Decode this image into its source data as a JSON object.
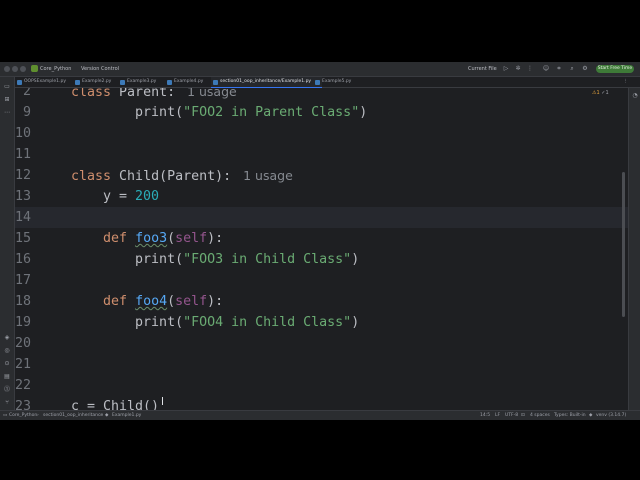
{
  "titlebar": {
    "project": "Core_Python",
    "vcs": "Version Control",
    "run_config": "Current File",
    "start_free_time": "Start Free Time"
  },
  "tabs": [
    {
      "label": "OOPSExample1.py",
      "active": false
    },
    {
      "label": "Example2.py",
      "active": false
    },
    {
      "label": "Example3.py",
      "active": false
    },
    {
      "label": "Example4.py",
      "active": false
    },
    {
      "label": "section01_oop_inheritance/Example1.py",
      "active": true
    },
    {
      "label": "Example5.py",
      "active": false
    }
  ],
  "inspections": {
    "warnings": "1",
    "weak": "1"
  },
  "editor": {
    "lines": [
      {
        "n": "2",
        "parts": [
          {
            "t": "kw",
            "v": "class "
          },
          {
            "t": "cls",
            "v": "Parent: "
          },
          {
            "t": "hint",
            "v": " 1 usage"
          }
        ]
      },
      {
        "n": "9",
        "parts": [
          {
            "t": "txt",
            "v": "        print("
          },
          {
            "t": "str",
            "v": "\"FOO2 in Parent Class\""
          },
          {
            "t": "txt",
            "v": ")"
          }
        ]
      },
      {
        "n": "10",
        "parts": []
      },
      {
        "n": "11",
        "parts": []
      },
      {
        "n": "12",
        "parts": [
          {
            "t": "kw",
            "v": "class "
          },
          {
            "t": "cls",
            "v": "Child(Parent): "
          },
          {
            "t": "hint",
            "v": " 1 usage"
          }
        ]
      },
      {
        "n": "13",
        "parts": [
          {
            "t": "txt",
            "v": "    y = "
          },
          {
            "t": "num",
            "v": "200"
          }
        ]
      },
      {
        "n": "14",
        "parts": [],
        "current": true
      },
      {
        "n": "15",
        "parts": [
          {
            "t": "txt",
            "v": "    "
          },
          {
            "t": "kw",
            "v": "def "
          },
          {
            "t": "fn",
            "v": "foo3"
          },
          {
            "t": "txt",
            "v": "("
          },
          {
            "t": "self",
            "v": "self"
          },
          {
            "t": "txt",
            "v": "):"
          }
        ]
      },
      {
        "n": "16",
        "parts": [
          {
            "t": "txt",
            "v": "        print("
          },
          {
            "t": "str",
            "v": "\"FOO3 in Child Class\""
          },
          {
            "t": "txt",
            "v": ")"
          }
        ]
      },
      {
        "n": "17",
        "parts": []
      },
      {
        "n": "18",
        "parts": [
          {
            "t": "txt",
            "v": "    "
          },
          {
            "t": "kw",
            "v": "def "
          },
          {
            "t": "fn",
            "v": "foo4"
          },
          {
            "t": "txt",
            "v": "("
          },
          {
            "t": "self",
            "v": "self"
          },
          {
            "t": "txt",
            "v": "):"
          }
        ]
      },
      {
        "n": "19",
        "parts": [
          {
            "t": "txt",
            "v": "        print("
          },
          {
            "t": "str",
            "v": "\"FOO4 in Child Class\""
          },
          {
            "t": "txt",
            "v": ")"
          }
        ]
      },
      {
        "n": "20",
        "parts": []
      },
      {
        "n": "21",
        "parts": []
      },
      {
        "n": "22",
        "parts": []
      },
      {
        "n": "23",
        "parts": [
          {
            "t": "txt",
            "v": "c = Child()"
          }
        ]
      }
    ]
  },
  "statusbar": {
    "breadcrumb_project": "Core_Python",
    "breadcrumb_folder": "section01_oop_inheritance",
    "breadcrumb_file": "Example1.py",
    "position": "14:5",
    "line_sep": "LF",
    "encoding": "UTF-8",
    "indent": "4 spaces",
    "types": "Types: Built-in",
    "interpreter": "venv (3.14.7)"
  },
  "colors": {
    "background": "#1e1f22",
    "keyword": "#cf8e6d",
    "string": "#6aab73",
    "number": "#2aacb8",
    "function": "#56a8f5",
    "self": "#94558d",
    "accent": "#3574f0"
  }
}
